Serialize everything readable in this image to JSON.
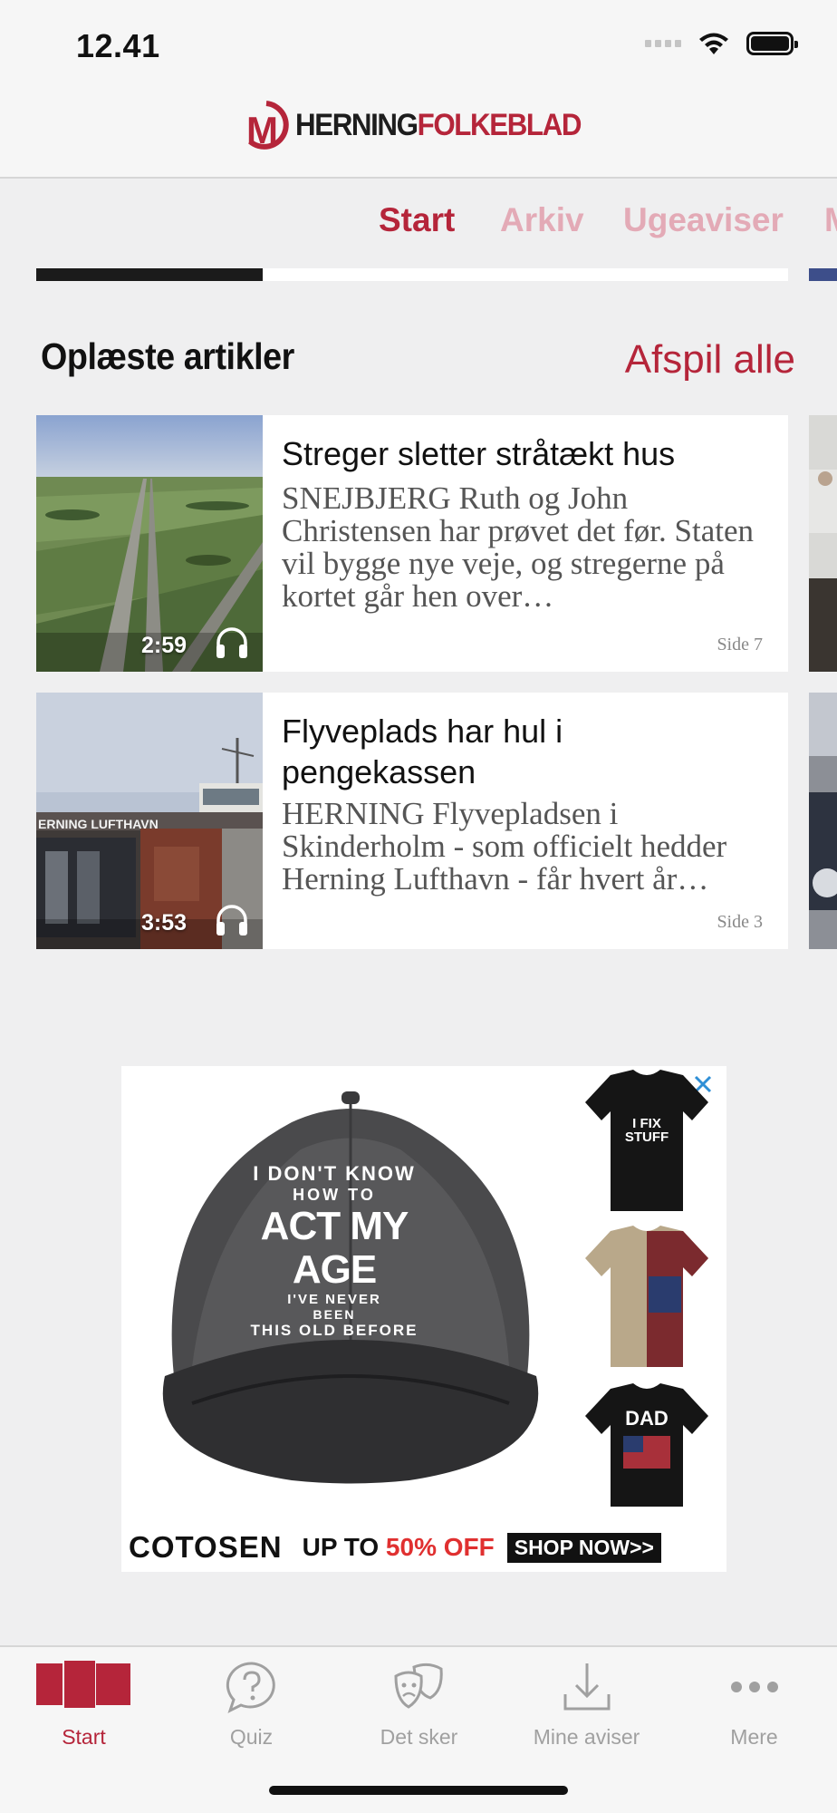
{
  "status_bar": {
    "time": "12.41"
  },
  "header": {
    "logo_word_1": "HERNING",
    "logo_word_2": "FOLKEBLAD"
  },
  "tabs": [
    {
      "label": "Start",
      "active": true
    },
    {
      "label": "Arkiv",
      "active": false
    },
    {
      "label": "Ugeaviser",
      "active": false
    },
    {
      "label": "M",
      "active": false
    }
  ],
  "section": {
    "title": "Oplæste artikler",
    "play_all": "Afspil alle"
  },
  "articles": [
    {
      "title": "Streger sletter stråtækt hus",
      "excerpt": "SNEJBJERG Ruth og John Christensen har prøvet det før. Staten vil bygge nye veje, og stregerne på kortet går hen over…",
      "duration": "2:59",
      "page": "Side 7",
      "thumb_icon": "aerial-road-photo"
    },
    {
      "title": "Flyveplads har hul i pengekassen",
      "excerpt": "HERNING Flyvepladsen i Skinderholm - som officielt hedder Herning Lufthavn - får hvert år…",
      "duration": "3:53",
      "page": "Side 3",
      "thumb_icon": "airport-terminal-photo",
      "thumb_sign": "ERNING LUFTHAVN"
    }
  ],
  "ad": {
    "cap_line1": "I DON'T KNOW",
    "cap_line2": "HOW TO",
    "cap_line3": "ACT MY AGE",
    "cap_line4": "I'VE NEVER",
    "cap_line5": "BEEN",
    "cap_line6": "THIS OLD BEFORE",
    "shirt1_text": "I FIX STUFF",
    "shirt3_text": "DAD",
    "brand": "COTOSEN",
    "promo_prefix": "UP TO",
    "promo_highlight": "50% OFF",
    "cta": "SHOP NOW>>"
  },
  "bottom_nav": [
    {
      "label": "Start",
      "icon": "pages-icon",
      "active": true
    },
    {
      "label": "Quiz",
      "icon": "question-bubble-icon",
      "active": false
    },
    {
      "label": "Det sker",
      "icon": "theater-masks-icon",
      "active": false
    },
    {
      "label": "Mine aviser",
      "icon": "download-icon",
      "active": false
    },
    {
      "label": "Mere",
      "icon": "more-dots-icon",
      "active": false
    }
  ],
  "colors": {
    "accent": "#b5253a",
    "accent_light": "#e3aab6",
    "background": "#efeff0",
    "inactive": "#a0a0a0"
  }
}
